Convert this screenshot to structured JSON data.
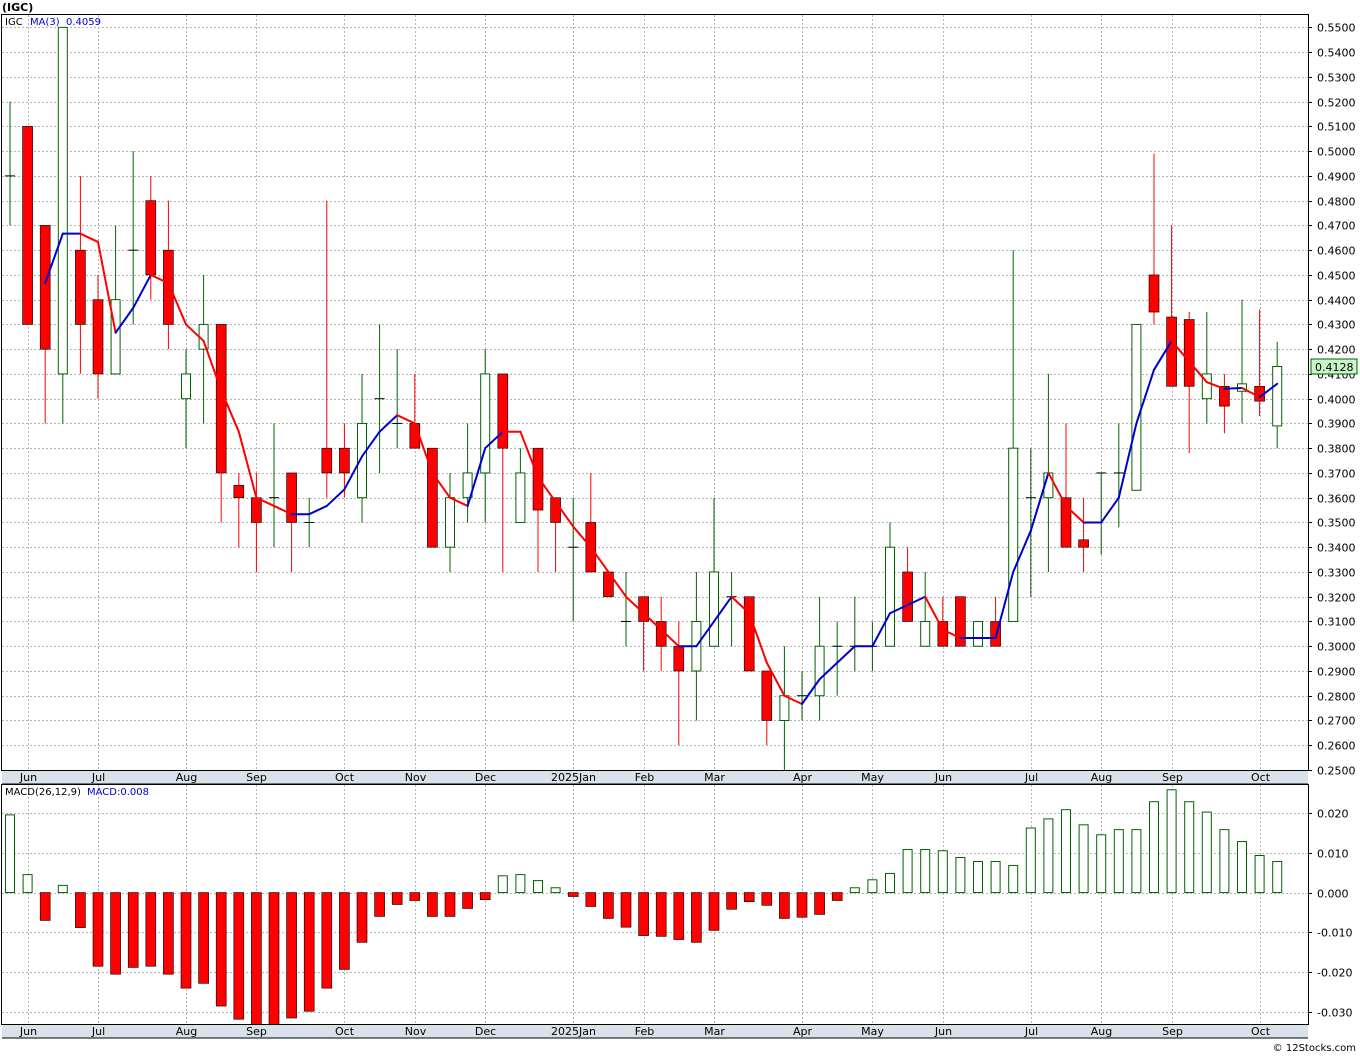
{
  "header": {
    "symbol": "(IGC)"
  },
  "price_panel": {
    "symbol_label": "IGC",
    "ma_label": "MA(3)",
    "ma_value": "0.4059",
    "last_price": "0.4128"
  },
  "macd_panel": {
    "label": "MACD(26,12,9)",
    "value_label": "MACD:0.008"
  },
  "footer": {
    "watermark": "© 12Stocks.com"
  },
  "colors": {
    "up": "#006400",
    "down": "#ff0000",
    "ma_up": "#0000cc",
    "ma_down": "#ff0000",
    "grid": "#b4b4b4",
    "panel_border": "#000000",
    "axis_bg": "#d9e2ea",
    "price_tag": "#c8f5c8"
  },
  "chart_data": [
    {
      "type": "candlestick",
      "title": "(IGC)",
      "ylim": [
        0.25,
        0.555
      ],
      "y_ticks": [
        "0.2500",
        "0.2600",
        "0.2700",
        "0.2800",
        "0.2900",
        "0.3000",
        "0.3100",
        "0.3200",
        "0.3300",
        "0.3400",
        "0.3500",
        "0.3600",
        "0.3700",
        "0.3800",
        "0.3900",
        "0.4000",
        "0.4100",
        "0.4200",
        "0.4300",
        "0.4400",
        "0.4500",
        "0.4600",
        "0.4700",
        "0.4800",
        "0.4900",
        "0.5000",
        "0.5100",
        "0.5200",
        "0.5300",
        "0.5400",
        "0.5500"
      ],
      "x_month_labels": [
        {
          "label": "Jun",
          "week": 1
        },
        {
          "label": "Jul",
          "week": 5
        },
        {
          "label": "Aug",
          "week": 10
        },
        {
          "label": "Sep",
          "week": 14
        },
        {
          "label": "Oct",
          "week": 19
        },
        {
          "label": "Nov",
          "week": 23
        },
        {
          "label": "Dec",
          "week": 27
        },
        {
          "label": "2025Jan",
          "week": 32
        },
        {
          "label": "Feb",
          "week": 36
        },
        {
          "label": "Mar",
          "week": 40
        },
        {
          "label": "Apr",
          "week": 45
        },
        {
          "label": "May",
          "week": 49
        },
        {
          "label": "Jun",
          "week": 53
        },
        {
          "label": "Jul",
          "week": 58
        },
        {
          "label": "Aug",
          "week": 62
        },
        {
          "label": "Sep",
          "week": 66
        },
        {
          "label": "Oct",
          "week": 71
        }
      ],
      "candles": [
        {
          "o": 0.49,
          "h": 0.52,
          "l": 0.47,
          "c": 0.49
        },
        {
          "o": 0.51,
          "h": 0.51,
          "l": 0.43,
          "c": 0.43
        },
        {
          "o": 0.47,
          "h": 0.47,
          "l": 0.39,
          "c": 0.42
        },
        {
          "o": 0.41,
          "h": 0.55,
          "l": 0.39,
          "c": 0.55
        },
        {
          "o": 0.46,
          "h": 0.49,
          "l": 0.41,
          "c": 0.43
        },
        {
          "o": 0.44,
          "h": 0.45,
          "l": 0.4,
          "c": 0.41
        },
        {
          "o": 0.41,
          "h": 0.47,
          "l": 0.41,
          "c": 0.44
        },
        {
          "o": 0.46,
          "h": 0.5,
          "l": 0.43,
          "c": 0.46
        },
        {
          "o": 0.48,
          "h": 0.49,
          "l": 0.44,
          "c": 0.45
        },
        {
          "o": 0.46,
          "h": 0.48,
          "l": 0.42,
          "c": 0.43
        },
        {
          "o": 0.4,
          "h": 0.42,
          "l": 0.38,
          "c": 0.41
        },
        {
          "o": 0.42,
          "h": 0.45,
          "l": 0.39,
          "c": 0.43
        },
        {
          "o": 0.43,
          "h": 0.43,
          "l": 0.35,
          "c": 0.37
        },
        {
          "o": 0.365,
          "h": 0.37,
          "l": 0.34,
          "c": 0.36
        },
        {
          "o": 0.36,
          "h": 0.37,
          "l": 0.33,
          "c": 0.35
        },
        {
          "o": 0.36,
          "h": 0.39,
          "l": 0.34,
          "c": 0.36
        },
        {
          "o": 0.37,
          "h": 0.37,
          "l": 0.33,
          "c": 0.35
        },
        {
          "o": 0.35,
          "h": 0.36,
          "l": 0.34,
          "c": 0.35
        },
        {
          "o": 0.38,
          "h": 0.48,
          "l": 0.36,
          "c": 0.37
        },
        {
          "o": 0.38,
          "h": 0.39,
          "l": 0.36,
          "c": 0.37
        },
        {
          "o": 0.36,
          "h": 0.41,
          "l": 0.35,
          "c": 0.39
        },
        {
          "o": 0.4,
          "h": 0.43,
          "l": 0.37,
          "c": 0.4
        },
        {
          "o": 0.39,
          "h": 0.42,
          "l": 0.38,
          "c": 0.39
        },
        {
          "o": 0.39,
          "h": 0.41,
          "l": 0.38,
          "c": 0.38
        },
        {
          "o": 0.38,
          "h": 0.38,
          "l": 0.34,
          "c": 0.34
        },
        {
          "o": 0.34,
          "h": 0.37,
          "l": 0.33,
          "c": 0.36
        },
        {
          "o": 0.36,
          "h": 0.39,
          "l": 0.35,
          "c": 0.37
        },
        {
          "o": 0.37,
          "h": 0.42,
          "l": 0.35,
          "c": 0.41
        },
        {
          "o": 0.41,
          "h": 0.41,
          "l": 0.33,
          "c": 0.38
        },
        {
          "o": 0.35,
          "h": 0.38,
          "l": 0.35,
          "c": 0.37
        },
        {
          "o": 0.38,
          "h": 0.38,
          "l": 0.33,
          "c": 0.355
        },
        {
          "o": 0.36,
          "h": 0.36,
          "l": 0.33,
          "c": 0.35
        },
        {
          "o": 0.34,
          "h": 0.36,
          "l": 0.31,
          "c": 0.34
        },
        {
          "o": 0.35,
          "h": 0.37,
          "l": 0.33,
          "c": 0.33
        },
        {
          "o": 0.33,
          "h": 0.33,
          "l": 0.32,
          "c": 0.32
        },
        {
          "o": 0.31,
          "h": 0.33,
          "l": 0.3,
          "c": 0.31
        },
        {
          "o": 0.32,
          "h": 0.32,
          "l": 0.29,
          "c": 0.31
        },
        {
          "o": 0.31,
          "h": 0.32,
          "l": 0.29,
          "c": 0.3
        },
        {
          "o": 0.3,
          "h": 0.31,
          "l": 0.26,
          "c": 0.29
        },
        {
          "o": 0.29,
          "h": 0.33,
          "l": 0.27,
          "c": 0.31
        },
        {
          "o": 0.3,
          "h": 0.36,
          "l": 0.3,
          "c": 0.33
        },
        {
          "o": 0.32,
          "h": 0.33,
          "l": 0.3,
          "c": 0.32
        },
        {
          "o": 0.32,
          "h": 0.32,
          "l": 0.29,
          "c": 0.29
        },
        {
          "o": 0.29,
          "h": 0.29,
          "l": 0.26,
          "c": 0.27
        },
        {
          "o": 0.27,
          "h": 0.3,
          "l": 0.25,
          "c": 0.28
        },
        {
          "o": 0.28,
          "h": 0.29,
          "l": 0.27,
          "c": 0.28
        },
        {
          "o": 0.28,
          "h": 0.32,
          "l": 0.27,
          "c": 0.3
        },
        {
          "o": 0.3,
          "h": 0.31,
          "l": 0.28,
          "c": 0.3
        },
        {
          "o": 0.3,
          "h": 0.32,
          "l": 0.29,
          "c": 0.3
        },
        {
          "o": 0.3,
          "h": 0.31,
          "l": 0.29,
          "c": 0.3
        },
        {
          "o": 0.3,
          "h": 0.35,
          "l": 0.3,
          "c": 0.34
        },
        {
          "o": 0.33,
          "h": 0.34,
          "l": 0.31,
          "c": 0.31
        },
        {
          "o": 0.3,
          "h": 0.33,
          "l": 0.3,
          "c": 0.31
        },
        {
          "o": 0.31,
          "h": 0.32,
          "l": 0.3,
          "c": 0.3
        },
        {
          "o": 0.32,
          "h": 0.32,
          "l": 0.3,
          "c": 0.3
        },
        {
          "o": 0.3,
          "h": 0.31,
          "l": 0.3,
          "c": 0.31
        },
        {
          "o": 0.31,
          "h": 0.32,
          "l": 0.3,
          "c": 0.3
        },
        {
          "o": 0.31,
          "h": 0.46,
          "l": 0.31,
          "c": 0.38
        },
        {
          "o": 0.36,
          "h": 0.38,
          "l": 0.32,
          "c": 0.36
        },
        {
          "o": 0.36,
          "h": 0.41,
          "l": 0.33,
          "c": 0.37
        },
        {
          "o": 0.36,
          "h": 0.39,
          "l": 0.34,
          "c": 0.34
        },
        {
          "o": 0.343,
          "h": 0.36,
          "l": 0.33,
          "c": 0.34
        },
        {
          "o": 0.37,
          "h": 0.37,
          "l": 0.337,
          "c": 0.37
        },
        {
          "o": 0.37,
          "h": 0.39,
          "l": 0.348,
          "c": 0.37
        },
        {
          "o": 0.363,
          "h": 0.43,
          "l": 0.363,
          "c": 0.43
        },
        {
          "o": 0.45,
          "h": 0.499,
          "l": 0.43,
          "c": 0.435
        },
        {
          "o": 0.433,
          "h": 0.47,
          "l": 0.42,
          "c": 0.405
        },
        {
          "o": 0.432,
          "h": 0.435,
          "l": 0.378,
          "c": 0.405
        },
        {
          "o": 0.4,
          "h": 0.435,
          "l": 0.39,
          "c": 0.41
        },
        {
          "o": 0.405,
          "h": 0.41,
          "l": 0.386,
          "c": 0.397
        },
        {
          "o": 0.403,
          "h": 0.44,
          "l": 0.39,
          "c": 0.406
        },
        {
          "o": 0.405,
          "h": 0.436,
          "l": 0.393,
          "c": 0.399
        },
        {
          "o": 0.389,
          "h": 0.423,
          "l": 0.38,
          "c": 0.413
        }
      ]
    },
    {
      "type": "bar",
      "title": "MACD(26,12,9)",
      "ylim": [
        -0.033,
        0.027
      ],
      "y_ticks": [
        "-0.030",
        "-0.020",
        "-0.010",
        "0.000",
        "0.010",
        "0.020"
      ],
      "values": [
        0.0195,
        0.0045,
        -0.007,
        0.0018,
        -0.0088,
        -0.0185,
        -0.0205,
        -0.0188,
        -0.0185,
        -0.0205,
        -0.024,
        -0.0228,
        -0.0285,
        -0.0318,
        -0.035,
        -0.034,
        -0.0315,
        -0.0298,
        -0.024,
        -0.0193,
        -0.0125,
        -0.006,
        -0.003,
        -0.002,
        -0.006,
        -0.006,
        -0.004,
        -0.0018,
        0.0042,
        0.0045,
        0.003,
        0.0012,
        -0.001,
        -0.0035,
        -0.0065,
        -0.0087,
        -0.0108,
        -0.011,
        -0.0118,
        -0.0125,
        -0.0095,
        -0.0042,
        -0.0023,
        -0.0032,
        -0.0065,
        -0.0062,
        -0.0055,
        -0.002,
        0.0012,
        0.0032,
        0.0048,
        0.0108,
        0.0108,
        0.0105,
        0.0088,
        0.0078,
        0.0078,
        0.0068,
        0.0162,
        0.0185,
        0.0208,
        0.017,
        0.0145,
        0.0158,
        0.0158,
        0.0228,
        0.0258,
        0.0228,
        0.0202,
        0.0158,
        0.0128,
        0.0093,
        0.0078
      ]
    }
  ]
}
